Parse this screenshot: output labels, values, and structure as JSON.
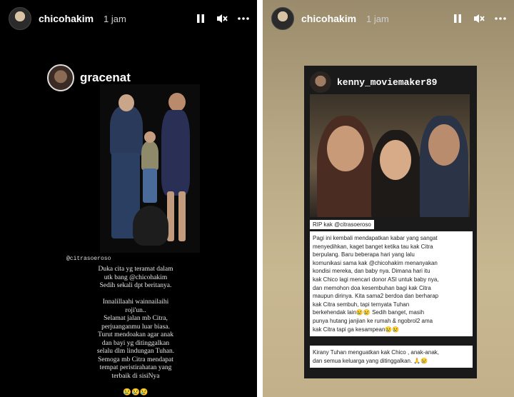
{
  "left_story": {
    "username": "chicohakim",
    "time": "1 jam",
    "repost_username": "gracenat",
    "photo_tag": "@citrasoeroso",
    "caption": "Duka cita yg teramat dalam\nutk bang @chicohakim\nSedih sekali dpt beritanya.\n\nInnalillaahi wainnailaihi\nroji'un..\nSelamat jalan mb Citra,\nperjuanganmu luar biasa.\nTurut mendoakan agar anak\ndan bayi yg ditinggalkan\nselalu dlm lindungan Tuhan.\nSemoga mb Citra mendapat\ntempat peristirahatan yang\nterbaik di sisiNya\n\n😢😢😢"
  },
  "right_story": {
    "username": "chicohakim",
    "time": "1 jam",
    "repost_username": "kenny_moviemaker89",
    "rip_text": "RIP kak @citrasoeroso",
    "body_text": "Pagi ini kembali mendapatkan kabar yang sangat\nmenyedihkan, kaget banget ketika tau kak Citra\nberpulang. Baru beberapa hari yang lalu\nkomunikasi sama kak @chicohakim menanyakan\nkondisi mereka, dan baby nya. Dimana hari itu\nkak Chico lagi mencari donor ASI untuk baby nya,\ndan memohon doa kesembuhan bagi kak Citra\nmaupun dirinya. Kita sama2 berdoa dan berharap\nkak Citra sembuh, tapi ternyata Tuhan\nberkehendak lain😢😢 Sedih banget, masih\npunya hutang janjian ke rumah & ngobrol2 ama\nkak Citra tapi ga kesampean😢😢",
    "closing_text": "Kirany Tuhan menguatkan kak Chico , anak-anak,\ndan semua keluarga yang ditinggalkan. 🙏😢"
  },
  "icons": {
    "pause": "pause-icon",
    "mute": "mute-icon",
    "more": "more-icon"
  }
}
